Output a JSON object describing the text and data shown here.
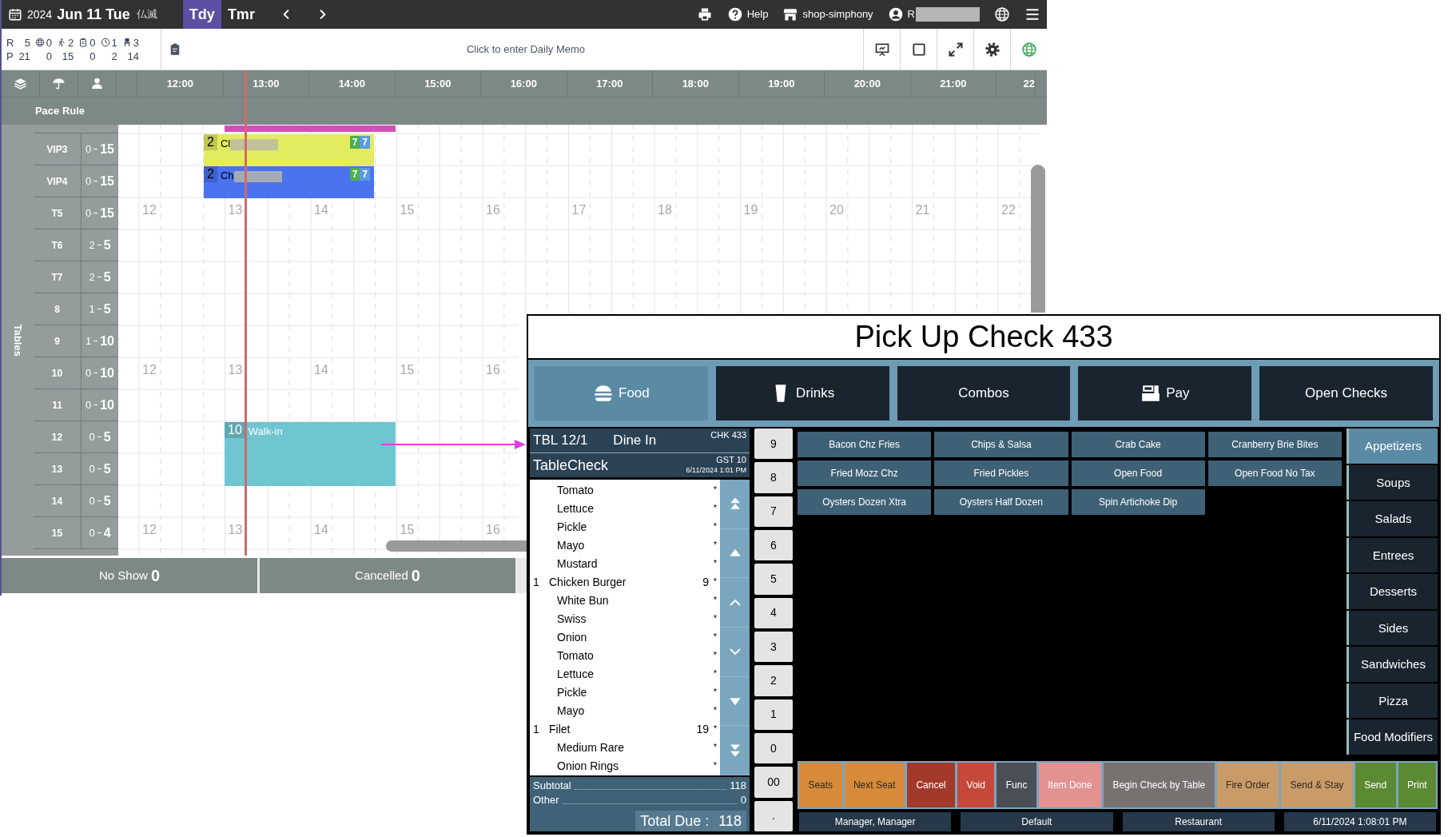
{
  "scheduler": {
    "date": {
      "year": "2024",
      "day": "Jun 11 Tue",
      "rokuyo": "仏滅"
    },
    "day_tabs": [
      {
        "label": "Tdy",
        "selected": true
      },
      {
        "label": "Tmr",
        "selected": false
      }
    ],
    "toolbar": [
      {
        "kind": "print"
      },
      {
        "kind": "help",
        "label": "Help"
      },
      {
        "kind": "store",
        "label": "shop-simphony"
      },
      {
        "kind": "user",
        "label": "R",
        "redacted": true
      },
      {
        "kind": "globe"
      },
      {
        "kind": "menu"
      }
    ],
    "stats": {
      "row_labels": [
        "R",
        "P"
      ],
      "columns": [
        {
          "kind": "plain",
          "r": "5",
          "p": "21"
        },
        {
          "kind": "globe",
          "r": "0",
          "p": "0"
        },
        {
          "kind": "walk",
          "r": "2",
          "p": "15"
        },
        {
          "kind": "clipboard",
          "r": "0",
          "p": "0"
        },
        {
          "kind": "clock",
          "r": "1",
          "p": "2"
        },
        {
          "kind": "chair",
          "r": "3",
          "p": "14"
        }
      ]
    },
    "memo": {
      "placeholder": "Click to enter Daily Memo"
    },
    "hours": [
      "12:00",
      "13:00",
      "14:00",
      "15:00",
      "16:00",
      "17:00",
      "18:00",
      "19:00",
      "20:00",
      "21:00",
      "22"
    ],
    "pace_rule": "Pace Rule",
    "side_label": "Tables",
    "tables": [
      {
        "name": "VIP3",
        "min": "0",
        "max": "15",
        "booking": {
          "kind": "reservation",
          "party": "2",
          "name": "Cl",
          "redacted": true,
          "color": "#e3ec5f",
          "badges": [
            {
              "text": "7",
              "color": "#4caf50"
            },
            {
              "text": "7",
              "color": "#5b9be0"
            }
          ]
        }
      },
      {
        "name": "VIP4",
        "min": "0",
        "max": "15",
        "booking": {
          "kind": "reservation",
          "party": "2",
          "name": "Ch",
          "redacted": true,
          "color": "#4b73f0",
          "badges": [
            {
              "text": "7",
              "color": "#4caf50"
            },
            {
              "text": "7",
              "color": "#5b9be0"
            }
          ]
        }
      },
      {
        "name": "T5",
        "min": "0",
        "max": "15",
        "hour_marks": [
          "12",
          "13",
          "14",
          "15",
          "16",
          "17",
          "18",
          "19",
          "20",
          "21",
          "22"
        ]
      },
      {
        "name": "T6",
        "min": "2",
        "max": "5"
      },
      {
        "name": "T7",
        "min": "2",
        "max": "5"
      },
      {
        "name": "8",
        "min": "1",
        "max": "5"
      },
      {
        "name": "9",
        "min": "1",
        "max": "10"
      },
      {
        "name": "10",
        "min": "0",
        "max": "10",
        "hour_marks": [
          "12",
          "13",
          "14",
          "15",
          "16"
        ]
      },
      {
        "name": "11",
        "min": "0",
        "max": "10"
      },
      {
        "name": "12",
        "min": "0",
        "max": "5",
        "booking": {
          "kind": "walk_in",
          "party": "10",
          "name": "Walk-in",
          "color": "#6fc6d1"
        }
      },
      {
        "name": "13",
        "min": "0",
        "max": "5"
      },
      {
        "name": "14",
        "min": "0",
        "max": "5"
      },
      {
        "name": "15",
        "min": "0",
        "max": "4",
        "hour_marks": [
          "12",
          "13",
          "14",
          "15",
          "16"
        ]
      }
    ],
    "footer": [
      {
        "label": "No Show",
        "count": "0"
      },
      {
        "label": "Cancelled",
        "count": "0"
      }
    ]
  },
  "pos": {
    "title": "Pick Up Check 433",
    "tabs": [
      {
        "label": "Food",
        "kind": "food",
        "selected": true
      },
      {
        "label": "Drinks",
        "kind": "drinks",
        "selected": false
      },
      {
        "label": "Combos",
        "kind": "plain",
        "selected": false
      },
      {
        "label": "Pay",
        "kind": "pay",
        "selected": false
      },
      {
        "label": "Open Checks",
        "kind": "plain",
        "selected": false
      }
    ],
    "check": {
      "table": "TBL 12/1",
      "order_type": "Dine In",
      "check_no": "CHK 433",
      "name": "TableCheck",
      "guests": "GST 10",
      "opened": "6/11/2024 1:01 PM",
      "lines": [
        {
          "kind": "modifier",
          "name": "Tomato",
          "mark": "*"
        },
        {
          "kind": "modifier",
          "name": "Lettuce",
          "mark": "*"
        },
        {
          "kind": "modifier",
          "name": "Pickle",
          "mark": "*"
        },
        {
          "kind": "modifier",
          "name": "Mayo",
          "mark": "*"
        },
        {
          "kind": "modifier",
          "name": "Mustard",
          "mark": "*"
        },
        {
          "kind": "item",
          "qty": "1",
          "name": "Chicken Burger",
          "price": "9",
          "mark": "*"
        },
        {
          "kind": "modifier",
          "name": "White Bun",
          "mark": "*"
        },
        {
          "kind": "modifier",
          "name": "Swiss",
          "mark": "*"
        },
        {
          "kind": "modifier",
          "name": "Onion",
          "mark": "*"
        },
        {
          "kind": "modifier",
          "name": "Tomato",
          "mark": "*"
        },
        {
          "kind": "modifier",
          "name": "Lettuce",
          "mark": "*"
        },
        {
          "kind": "modifier",
          "name": "Pickle",
          "mark": "*"
        },
        {
          "kind": "modifier",
          "name": "Mayo",
          "mark": "*"
        },
        {
          "kind": "item",
          "qty": "1",
          "name": "Filet",
          "price": "19",
          "mark": "*"
        },
        {
          "kind": "modifier",
          "name": "Medium Rare",
          "mark": "*"
        },
        {
          "kind": "modifier",
          "name": "Onion Rings",
          "mark": "*"
        }
      ],
      "subtotal": {
        "label": "Subtotal",
        "value": "118"
      },
      "other": {
        "label": "Other",
        "value": "0"
      },
      "total": {
        "label": "Total Due :",
        "value": "118"
      }
    },
    "keypad": [
      "9",
      "8",
      "7",
      "6",
      "5",
      "4",
      "3",
      "2",
      "1",
      "0",
      "00",
      "."
    ],
    "menu_items": [
      "Bacon Chz Fries",
      "Chips & Salsa",
      "Crab Cake",
      "Cranberry Brie Bites",
      "Fried Mozz Chz",
      "Fried Pickles",
      "Open Food",
      "Open Food No Tax",
      "Oysters Dozen Xtra",
      "Oysters Half Dozen",
      "Spin Artichoke Dip"
    ],
    "categories": [
      {
        "label": "Appetizers",
        "selected": true
      },
      {
        "label": "Soups",
        "selected": false
      },
      {
        "label": "Salads",
        "selected": false
      },
      {
        "label": "Entrees",
        "selected": false
      },
      {
        "label": "Desserts",
        "selected": false
      },
      {
        "label": "Sides",
        "selected": false
      },
      {
        "label": "Sandwiches",
        "selected": false
      },
      {
        "label": "Pizza",
        "selected": false
      },
      {
        "label": "Food Modifiers",
        "selected": false
      }
    ],
    "actions": [
      {
        "label": "Seats",
        "color": "#d68a3a"
      },
      {
        "label": "Next Seat",
        "color": "#d68a3a"
      },
      {
        "label": "Cancel",
        "color": "#a2392b"
      },
      {
        "label": "Void",
        "color": "#c6483a"
      },
      {
        "label": "Func",
        "color": "#4a4e55"
      },
      {
        "label": "Item Done",
        "color": "#e49191"
      },
      {
        "label": "Begin Check by Table",
        "color": "#77726f"
      },
      {
        "label": "Fire Order",
        "color": "#c99b68"
      },
      {
        "label": "Send & Stay",
        "color": "#c99b68"
      },
      {
        "label": "Send",
        "color": "#5b8a33"
      },
      {
        "label": "Print",
        "color": "#5b8a33"
      }
    ],
    "status": [
      "Manager, Manager",
      "Default",
      "Restaurant",
      "6/11/2024 1:08:01 PM"
    ]
  }
}
